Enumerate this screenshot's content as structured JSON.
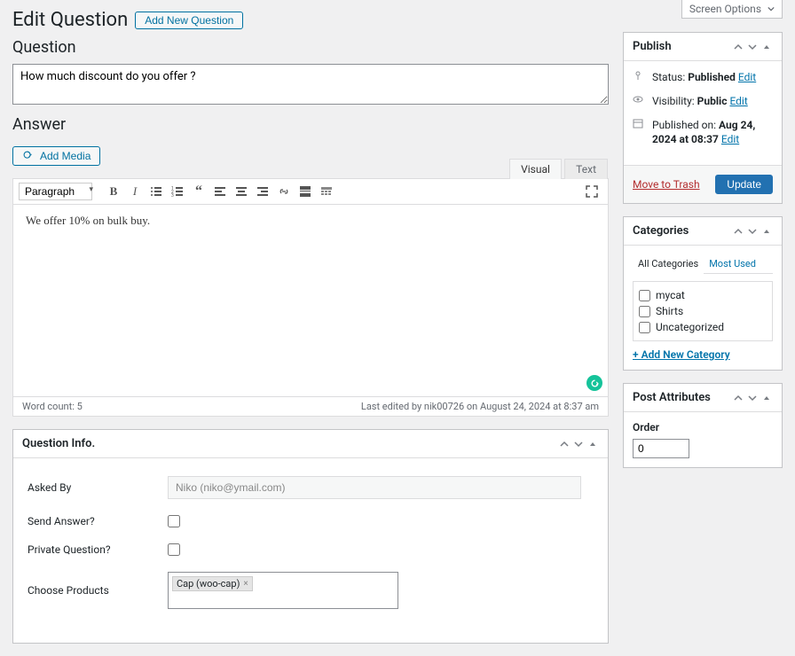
{
  "screen_options": {
    "label": "Screen Options"
  },
  "header": {
    "page_title": "Edit Question",
    "add_new_label": "Add New Question"
  },
  "question": {
    "section_label": "Question",
    "value": "How much discount do you offer ?"
  },
  "answer": {
    "section_label": "Answer",
    "add_media_label": "Add Media",
    "tabs": {
      "visual": "Visual",
      "text": "Text"
    },
    "para_select": "Paragraph",
    "content": "We offer 10% on bulk buy.",
    "word_count_label": "Word count: 5",
    "last_edited": "Last edited by nik00726 on August 24, 2024 at 8:37 am"
  },
  "publish": {
    "title": "Publish",
    "status_label": "Status:",
    "status_value": "Published",
    "visibility_label": "Visibility:",
    "visibility_value": "Public",
    "published_label": "Published on:",
    "published_value": "Aug 24, 2024 at 08:37",
    "edit_label": "Edit",
    "trash_label": "Move to Trash",
    "update_label": "Update"
  },
  "categories": {
    "title": "Categories",
    "tab_all": "All Categories",
    "tab_most": "Most Used",
    "items": [
      {
        "label": "mycat"
      },
      {
        "label": "Shirts"
      },
      {
        "label": "Uncategorized"
      }
    ],
    "add_new_label": "+ Add New Category"
  },
  "post_attributes": {
    "title": "Post Attributes",
    "order_label": "Order",
    "order_value": "0"
  },
  "question_info": {
    "title": "Question Info.",
    "asked_by_label": "Asked By",
    "asked_by_value": "Niko (niko@ymail.com)",
    "send_answer_label": "Send Answer?",
    "private_label": "Private Question?",
    "choose_products_label": "Choose Products",
    "product_chip": "Cap (woo-cap)"
  }
}
